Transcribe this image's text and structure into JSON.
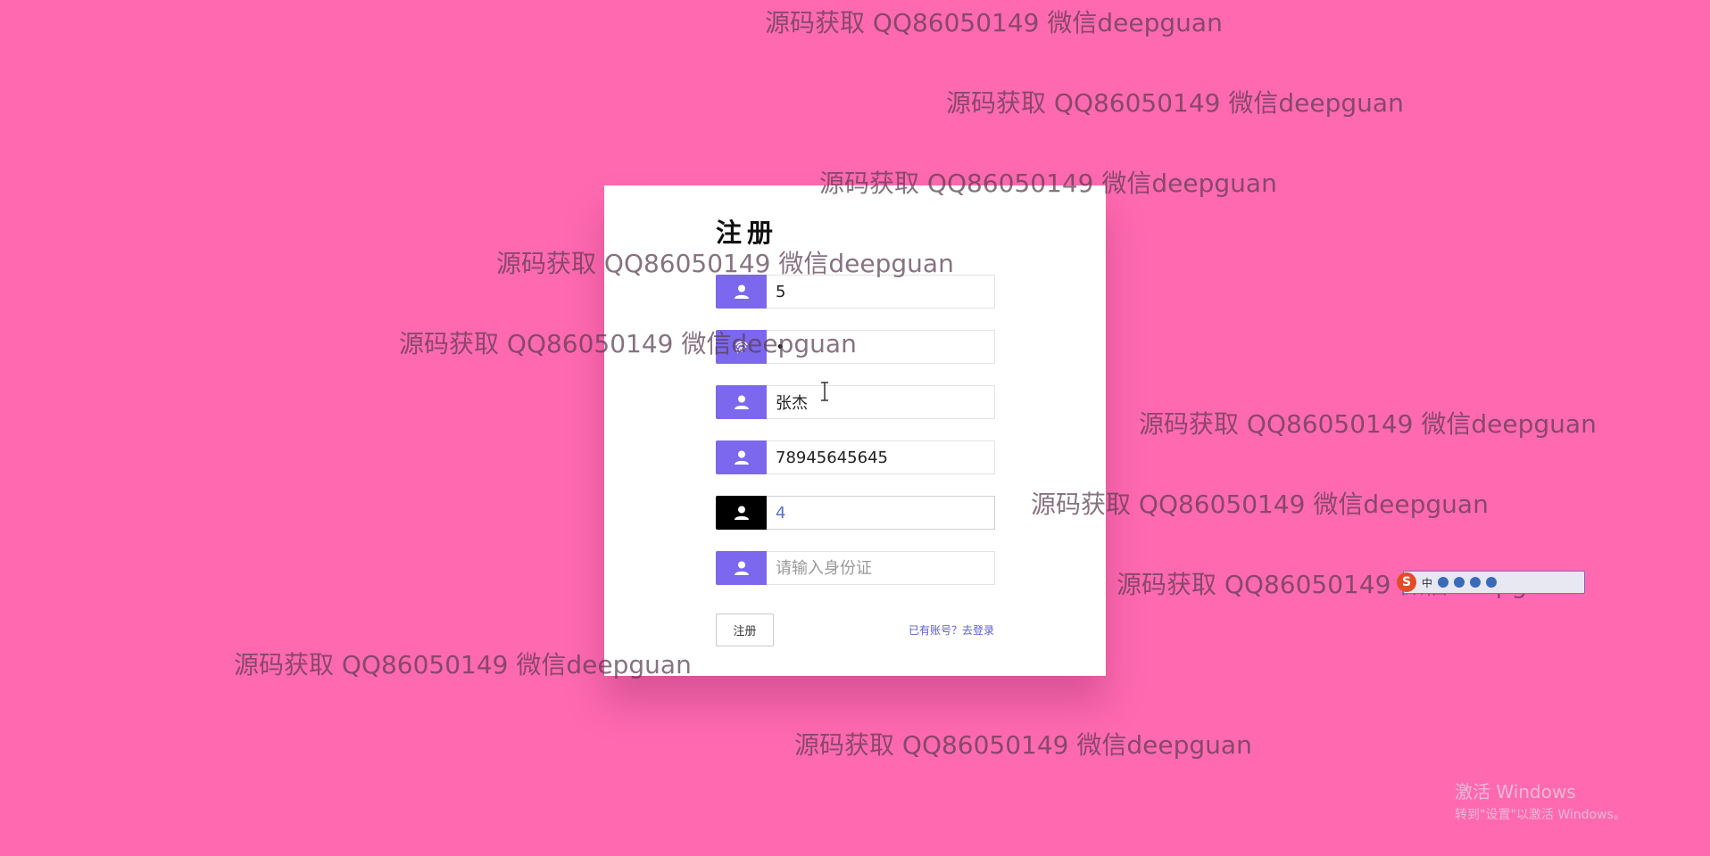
{
  "page": {
    "background": "#ff69b0"
  },
  "register_form": {
    "title": "注册",
    "accent_color": "#7b68ee",
    "fields": [
      {
        "icon": "user-icon",
        "value": "5",
        "placeholder": ""
      },
      {
        "icon": "fingerprint-icon",
        "value": "·",
        "placeholder": ""
      },
      {
        "icon": "user-icon",
        "value": "张杰",
        "placeholder": ""
      },
      {
        "icon": "user-icon",
        "value": "78945645645",
        "placeholder": ""
      },
      {
        "icon": "user-icon",
        "value": "4",
        "placeholder": ""
      },
      {
        "icon": "user-icon",
        "value": "",
        "placeholder": "请输入身份证"
      }
    ],
    "submit_label": "注册",
    "login_link": "已有账号？去登录"
  },
  "watermarks": [
    "源码获取 QQ86050149 微信deepguan",
    "源码获取 QQ86050149 微信deepguan",
    "源码获取 QQ86050149 微信deepguan",
    "源码获取 QQ86050149 微信deepguan",
    "源码获取 QQ86050149 微信deepguan",
    "源码获取 QQ86050149 微信deepguan",
    "源码获取 QQ86050149 微信deepguan",
    "源码获取 QQ86050149 微信deepguan",
    "源码获取 QQ86050149 微信deepguan",
    "源码获取 QQ86050149 微信deepguan"
  ],
  "ime_toolbar": {
    "label": "中"
  },
  "windows_activation": {
    "line1": "激活 Windows",
    "line2": "转到\"设置\"以激活 Windows。"
  }
}
